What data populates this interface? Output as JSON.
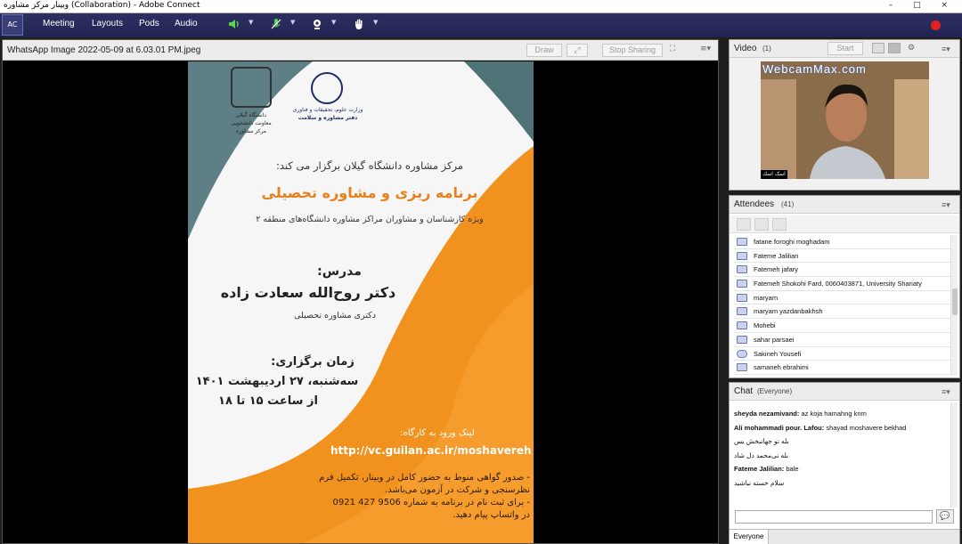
{
  "window": {
    "title": "وبینار مرکز مشاوره (Collaboration) - Adobe Connect",
    "controls": [
      "–",
      "□",
      "×"
    ]
  },
  "menu": {
    "logo_text": "AC",
    "items": [
      "Meeting",
      "Layouts",
      "Pods",
      "Audio"
    ],
    "toolbar_icons": [
      "speaker-icon",
      "microphone-icon",
      "webcam-icon",
      "raise-hand-icon"
    ],
    "record_color": "#e32020"
  },
  "share": {
    "title": "WhatsApp Image 2022-05-09 at 6.03.01 PM.jpeg",
    "draw_label": "Draw",
    "stop_label": "Stop Sharing",
    "menu_glyph": "≡▾",
    "poster": {
      "uni_name": "دانشگاه گیلان",
      "uni_sub1": "معاونت دانشجویی",
      "uni_sub2": "مرکز مشاوره",
      "ministry_line1": "وزارت علوم، تحقیقات و فناوری",
      "ministry_line2": "دفتر مشاوره و سلامت",
      "intro": "مرکز مشاوره دانشگاه گیلان برگزار می کند:",
      "headline": "برنامه ریزی و مشاوره تحصیلی",
      "audience": "ویژه کارشناسان و مشاوران مراکز مشاوره دانشگاه‌های منطقه ۲",
      "lecturer_label": "مدرس:",
      "lecturer_name": "دکتر روح‌الله سعادت زاده",
      "lecturer_degree": "دکتری مشاوره تحصیلی",
      "time_label": "زمان برگزاری:",
      "date": "سه‌شنبه، ۲۷ اردیبهشت ۱۴۰۱",
      "hours": "از ساعت ۱۵ تا ۱۸",
      "link_label": "لینک ورود به کارگاه:",
      "link_url": "http://vc.guilan.ac.ir/moshavereh",
      "note1": "- صدور گواهی منوط به حضور کامل در وبینار، تکمیل فرم",
      "note2": "نظرسنجی و شرکت در آزمون می‌باشد.",
      "note3": "- برای ثبت نام در برنامه به شماره 9506 427 0921",
      "note4": "در واتساپ پیام دهید."
    },
    "colors": {
      "teal": "#5d7f85",
      "orange": "#f2921e",
      "headline": "#e8801b"
    }
  },
  "video": {
    "title": "Video",
    "count": "(1)",
    "start_label": "Start",
    "watermark": "WebcamMax.com",
    "caption": "اسک اسك"
  },
  "attendees": {
    "title": "Attendees",
    "count": "(41)",
    "list": [
      "fatane foroghi moghadam",
      "Fateme Jalilian",
      "Fatemeh jafary",
      "Fatemeh Shokohi Fard, 0060403871, University Shariaty",
      "maryam",
      "maryam yazdanbakhsh",
      "Mohebi",
      "sahar parsaei",
      "Sakineh Yousefi",
      "samaneh ebrahimi"
    ]
  },
  "chat": {
    "title": "Chat",
    "audience": "(Everyone)",
    "messages": [
      {
        "from": "sheyda nezamivand:",
        "text": "az koja hamahng knm"
      },
      {
        "from": "Ali mohammadi pour. Lafou:",
        "text": "shayad moshavere bekhad"
      },
      {
        "from": "",
        "text": "بله تو جهانبخش یس"
      },
      {
        "from": "",
        "text": "بله نی‌محمد دل شاد"
      },
      {
        "from": "Fateme Jalilian:",
        "text": "bale"
      },
      {
        "from": "",
        "text": "سلام خسته نباشید"
      }
    ],
    "input_placeholder": "",
    "tab_label": "Everyone"
  }
}
